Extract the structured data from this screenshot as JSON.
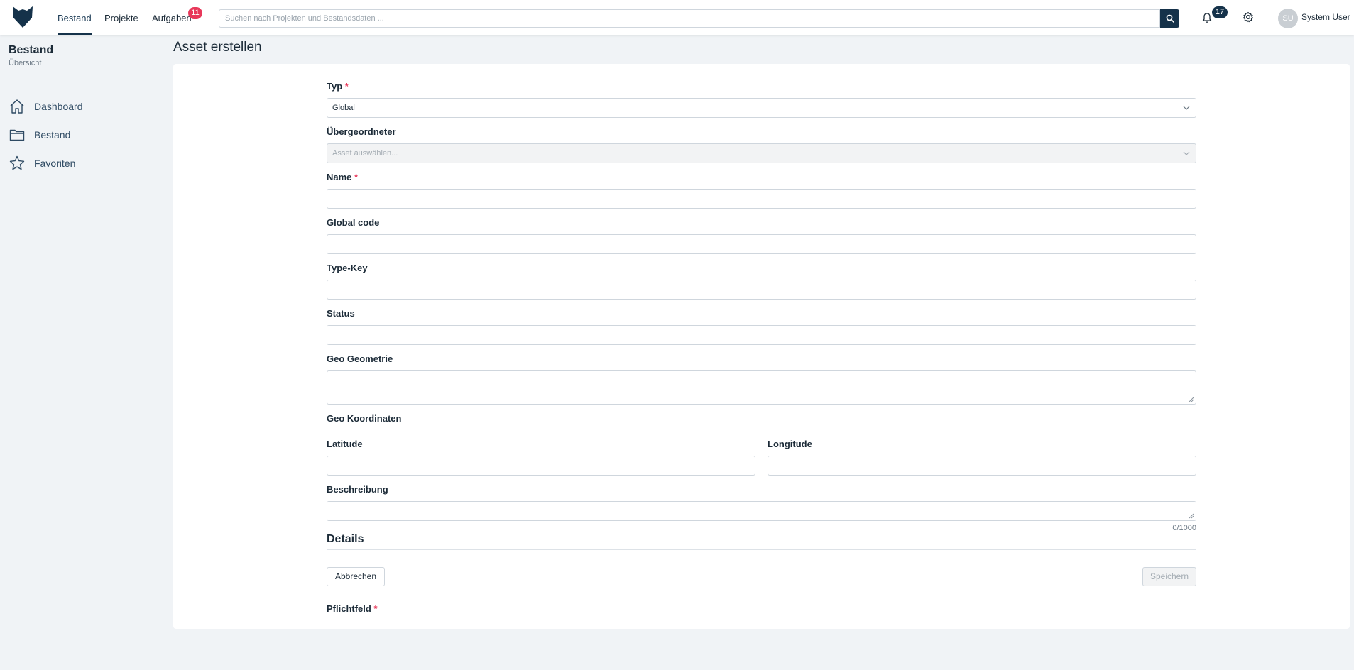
{
  "header": {
    "nav": [
      "Bestand",
      "Projekte",
      "Aufgaben"
    ],
    "tasks_badge": "11",
    "search_placeholder": "Suchen nach Projekten und Bestandsdaten ...",
    "notifications_badge": "17",
    "user_initials": "SU",
    "user_name": "System User",
    "icons": [
      "logo-icon",
      "search-icon",
      "bell-icon",
      "gear-icon"
    ]
  },
  "sidebar": {
    "title": "Bestand",
    "subtitle": "Übersicht",
    "items": [
      {
        "label": "Dashboard",
        "icon": "home-icon"
      },
      {
        "label": "Bestand",
        "icon": "folder-icon"
      },
      {
        "label": "Favoriten",
        "icon": "star-icon"
      }
    ]
  },
  "page": {
    "title": "Asset erstellen"
  },
  "form": {
    "typ_label": "Typ",
    "typ_value": "Global",
    "parent_label": "Übergeordneter",
    "parent_placeholder": "Asset auswählen...",
    "name_label": "Name",
    "global_code_label": "Global code",
    "type_key_label": "Type-Key",
    "status_label": "Status",
    "geo_geometrie_label": "Geo Geometrie",
    "geo_koordinaten_label": "Geo Koordinaten",
    "latitude_label": "Latitude",
    "longitude_label": "Longitude",
    "beschreibung_label": "Beschreibung",
    "beschreibung_counter": "0/1000",
    "details_title": "Details",
    "cancel_label": "Abbrechen",
    "save_label": "Speichern",
    "required_note": "Pflichtfeld",
    "required_marker": "*"
  },
  "colors": {
    "accent": "#15324a",
    "required": "#e8385a",
    "background": "#f0f3f6"
  }
}
